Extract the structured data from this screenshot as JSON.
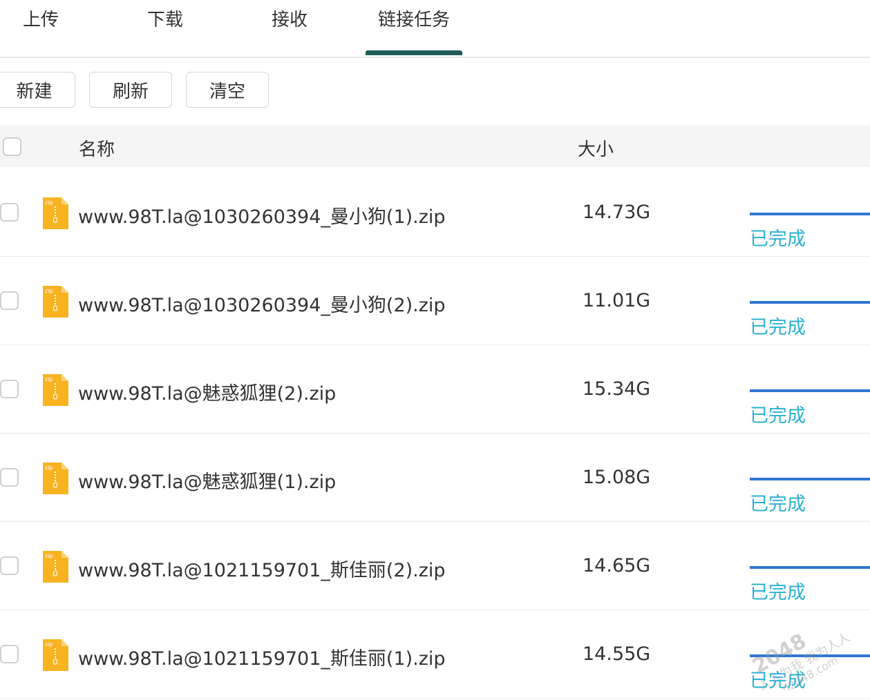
{
  "tabs": [
    {
      "label": "上传"
    },
    {
      "label": "下载"
    },
    {
      "label": "接收"
    },
    {
      "label": "链接任务",
      "active": true
    }
  ],
  "toolbar": {
    "new_label": "新建",
    "refresh_label": "刷新",
    "clear_label": "清空"
  },
  "table": {
    "header_name": "名称",
    "header_size": "大小",
    "rows": [
      {
        "name": "www.98T.la@1030260394_曼小狗(1).zip",
        "size": "14.73G",
        "status": "已完成",
        "progress": 1.0
      },
      {
        "name": "www.98T.la@1030260394_曼小狗(2).zip",
        "size": "11.01G",
        "status": "已完成",
        "progress": 1.0
      },
      {
        "name": "www.98T.la@魅惑狐狸(2).zip",
        "size": "15.34G",
        "status": "已完成",
        "progress": 1.0
      },
      {
        "name": "www.98T.la@魅惑狐狸(1).zip",
        "size": "15.08G",
        "status": "已完成",
        "progress": 1.0
      },
      {
        "name": "www.98T.la@1021159701_斯佳丽(2).zip",
        "size": "14.65G",
        "status": "已完成",
        "progress": 1.0
      },
      {
        "name": "www.98T.la@1021159701_斯佳丽(1).zip",
        "size": "14.55G",
        "status": "已完成",
        "progress": 1.0
      }
    ]
  },
  "icons": {
    "file": "zip-file-icon",
    "file_badge": "zip"
  },
  "watermark": {
    "line1": "2048",
    "line2": "人人为我 我为人人",
    "line3": "d2048.com"
  },
  "colors": {
    "tab_indicator": "#1f5c57",
    "progress": "#2f76d1",
    "status": "#2bb0d1",
    "zip_icon": "#f8b321"
  }
}
